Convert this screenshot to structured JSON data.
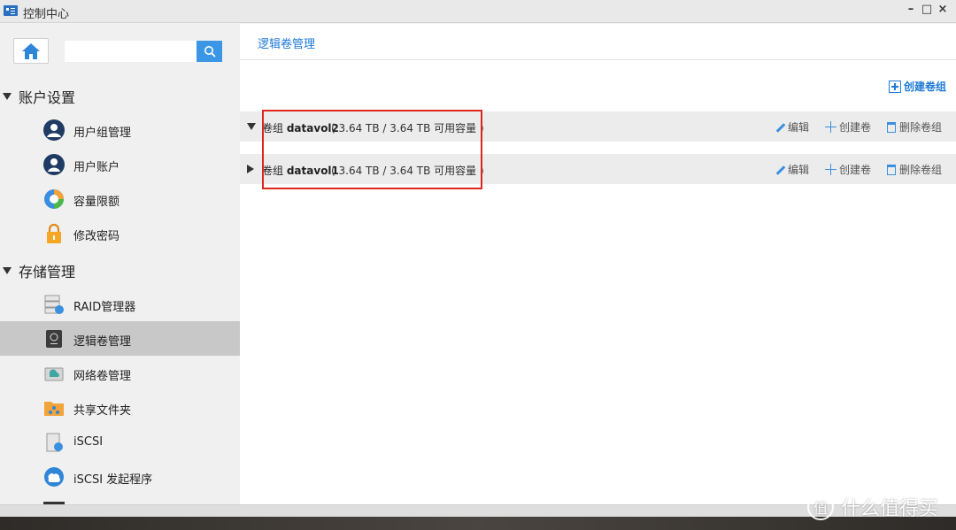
{
  "window": {
    "title": "控制中心",
    "minimize_label": "–",
    "maximize_label": "□",
    "close_label": "×"
  },
  "sidebar": {
    "search": {
      "placeholder": ""
    },
    "groups": [
      {
        "label": "账户设置",
        "items": [
          {
            "label": "用户组管理"
          },
          {
            "label": "用户账户"
          },
          {
            "label": "容量限额"
          },
          {
            "label": "修改密码"
          }
        ]
      },
      {
        "label": "存储管理",
        "items": [
          {
            "label": "RAID管理器"
          },
          {
            "label": "逻辑卷管理"
          },
          {
            "label": "网络卷管理"
          },
          {
            "label": "共享文件夹"
          },
          {
            "label": "iSCSI"
          },
          {
            "label": "iSCSI 发起程序"
          }
        ]
      }
    ]
  },
  "main": {
    "title": "逻辑卷管理",
    "create_group_label": "创建卷组",
    "volumes": [
      {
        "prefix": "卷组",
        "name": "datavol2",
        "capacity": "( 3.64 TB / 3.64 TB 可用容量 )"
      },
      {
        "prefix": "卷组",
        "name": "datavol1",
        "capacity": "( 3.64 TB / 3.64 TB 可用容量 )"
      }
    ],
    "actions": {
      "edit": "编辑",
      "create_volume": "创建卷",
      "delete_group": "删除卷组"
    }
  },
  "watermark": {
    "text": "什么值得买",
    "symbol": "值"
  },
  "colors": {
    "accent": "#1f7ad6",
    "highlight": "#e0251f",
    "active_item": "#c8c8c8"
  }
}
